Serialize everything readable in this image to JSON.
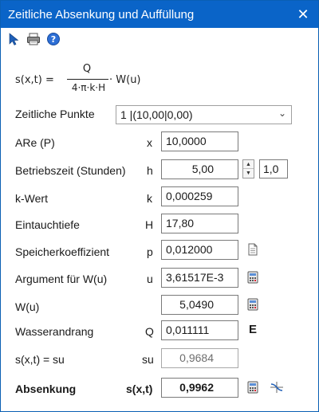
{
  "window": {
    "title": "Zeitliche Absenkung und Auffüllung",
    "close_symbol": "✕"
  },
  "toolbar": {
    "icons": [
      "pointer-icon",
      "print-icon",
      "help-icon"
    ]
  },
  "formula": {
    "lhs": "s(x,t) =",
    "numerator": "Q",
    "denominator": "4·π·k·H",
    "rhs": "· W(u)"
  },
  "zeitpunkte": {
    "label": "Zeitliche Punkte",
    "value": "1 |(10,00|0,00)"
  },
  "rows": {
    "are": {
      "label": "ARe (P)",
      "symbol": "x",
      "value": "10,0000"
    },
    "betriebszeit": {
      "label": "Betriebszeit (Stunden)",
      "symbol": "h",
      "value": "5,00",
      "step": "1,0"
    },
    "kwert": {
      "label": "k-Wert",
      "symbol": "k",
      "value": "0,000259"
    },
    "eintauchtiefe": {
      "label": "Eintauchtiefe",
      "symbol": "H",
      "value": "17,80"
    },
    "speicher": {
      "label": "Speicherkoeffizient",
      "symbol": "p",
      "value": "0,012000"
    },
    "argument": {
      "label": "Argument für W(u)",
      "symbol": "u",
      "value": "3,61517E-3"
    },
    "wu": {
      "label": "W(u)",
      "symbol": "",
      "value": "5,0490"
    },
    "wasserandrang": {
      "label": "Wasserandrang",
      "symbol": "Q",
      "value": "0,011111",
      "unit_mark": "E"
    },
    "su": {
      "label": "s(x,t) = su",
      "symbol": "su",
      "value": "0,9684"
    },
    "absenkung": {
      "label": "Absenkung",
      "symbol": "s(x,t)",
      "value": "0,9962"
    }
  }
}
